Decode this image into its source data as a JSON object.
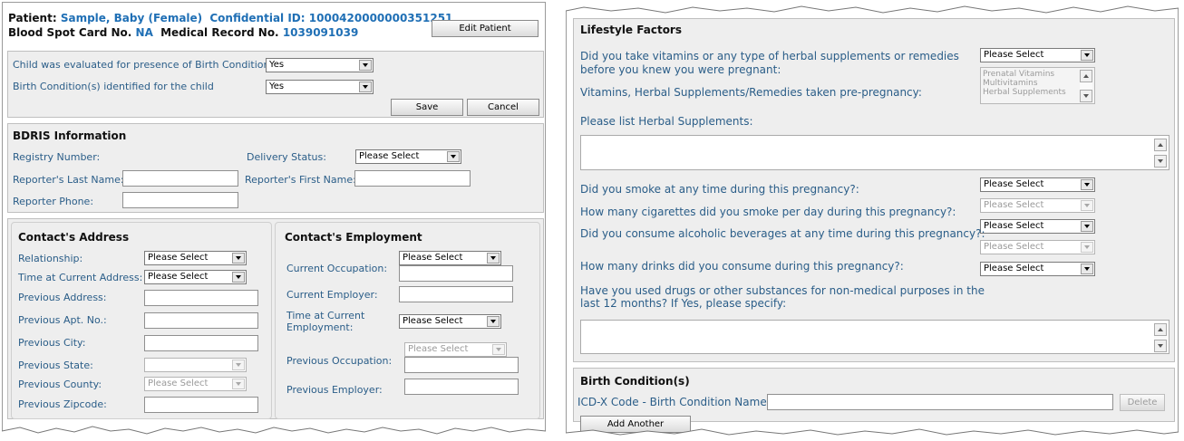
{
  "patient": {
    "patient_label": "Patient:",
    "patient_name": "Sample, Baby (Female)",
    "confidential_label": "Confidential ID:",
    "confidential_id": "1000420000000351251",
    "card_label": "Blood Spot Card No.",
    "card_value": "NA",
    "mrn_label": "Medical Record No.",
    "mrn_value": "1039091039",
    "edit_button": "Edit Patient"
  },
  "evaluation": {
    "evaluated_label": "Child was evaluated for presence of Birth Condition(s)",
    "evaluated_value": "Yes",
    "identified_label": "Birth Condition(s) identified for the child",
    "identified_value": "Yes",
    "save_button": "Save",
    "cancel_button": "Cancel"
  },
  "bdris": {
    "title": "BDRIS Information",
    "registry_label": "Registry Number:",
    "delivery_label": "Delivery Status:",
    "delivery_value": "Please Select",
    "reporter_last_label": "Reporter's Last Name:",
    "reporter_first_label": "Reporter's First Name:",
    "reporter_phone_label": "Reporter Phone:"
  },
  "address": {
    "title": "Contact's Address",
    "relationship_label": "Relationship:",
    "relationship_value": "Please Select",
    "time_label": "Time at Current Address:",
    "time_value": "Please Select",
    "prev_address_label": "Previous Address:",
    "prev_apt_label": "Previous Apt. No.:",
    "prev_city_label": "Previous City:",
    "prev_state_label": "Previous State:",
    "prev_county_label": "Previous County:",
    "prev_county_value": "Please Select",
    "prev_zip_label": "Previous Zipcode:"
  },
  "employment": {
    "title": "Contact's Employment",
    "occupation_label": "Current Occupation:",
    "occupation_value": "Please Select",
    "employer_label": "Current Employer:",
    "time_label_1": "Time at Current",
    "time_label_2": "Employment:",
    "time_value": "Please Select",
    "prev_occupation_label": "Previous Occupation:",
    "prev_occupation_value": "Please Select",
    "prev_employer_label": "Previous Employer:"
  },
  "lifestyle": {
    "title": "Lifestyle Factors",
    "vitamins_q_1": "Did you take vitamins or any type of herbal supplements or remedies",
    "vitamins_q_2": "before you knew you were pregnant:",
    "vitamins_value": "Please Select",
    "list_options": [
      "Prenatal Vitamins",
      "Multivitamins",
      "Herbal Supplements"
    ],
    "taken_label": "Vitamins, Herbal Supplements/Remedies taken pre-pregnancy:",
    "herbal_label": "Please list Herbal Supplements:",
    "smoke_q": "Did you smoke at any time during this pregnancy?:",
    "smoke_value": "Please Select",
    "cigs_q": "How many cigarettes did you smoke per day during this pregnancy?:",
    "cigs_value": "Please Select",
    "alcohol_q": "Did you consume alcoholic beverages at any time during this pregnancy?:",
    "alcohol_value": "Please Select",
    "alcohol_sub_value": "Please Select",
    "drinks_q": "How many drinks did you consume during this pregnancy?:",
    "drinks_value": "Please Select",
    "drugs_q_1": "Have you used drugs or other substances for non-medical purposes in the",
    "drugs_q_2": "last 12 months? If Yes, please specify:"
  },
  "birth_condition": {
    "title": "Birth Condition(s)",
    "icd_label": "ICD-X Code - Birth Condition Name:",
    "delete_button": "Delete",
    "add_button": "Add Another"
  },
  "colors": {
    "panel": "#eeeeee",
    "label": "#2a5d88",
    "value_blue": "#1f6fb5",
    "border": "#bfbfbf"
  }
}
